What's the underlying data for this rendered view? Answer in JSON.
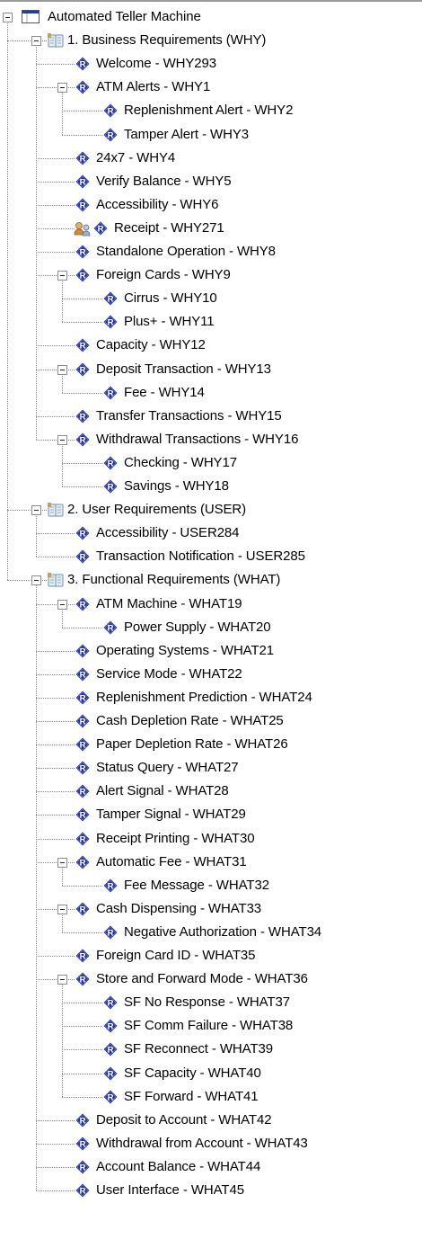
{
  "tree": {
    "root": {
      "label": "Automated Teller Machine",
      "icon": "window-icon"
    },
    "items": [
      {
        "label": "1. Business Requirements (WHY)",
        "level": 1,
        "icon": "book-icon",
        "expander": true
      },
      {
        "label": "Welcome - WHY293",
        "level": 2,
        "icon": "requirement-icon"
      },
      {
        "label": "ATM Alerts - WHY1",
        "level": 2,
        "icon": "requirement-icon",
        "expander": true
      },
      {
        "label": "Replenishment Alert - WHY2",
        "level": 3,
        "icon": "requirement-icon"
      },
      {
        "label": "Tamper Alert - WHY3",
        "level": 3,
        "icon": "requirement-icon"
      },
      {
        "label": "24x7 - WHY4",
        "level": 2,
        "icon": "requirement-icon"
      },
      {
        "label": "Verify Balance - WHY5",
        "level": 2,
        "icon": "requirement-icon"
      },
      {
        "label": "Accessibility - WHY6",
        "level": 2,
        "icon": "requirement-icon"
      },
      {
        "label": "Receipt - WHY271",
        "level": 2,
        "icon": "requirement-icon",
        "extra_icon": "users-icon"
      },
      {
        "label": "Standalone Operation - WHY8",
        "level": 2,
        "icon": "requirement-icon"
      },
      {
        "label": "Foreign Cards - WHY9",
        "level": 2,
        "icon": "requirement-icon",
        "expander": true
      },
      {
        "label": "Cirrus - WHY10",
        "level": 3,
        "icon": "requirement-icon"
      },
      {
        "label": "Plus+ - WHY11",
        "level": 3,
        "icon": "requirement-icon"
      },
      {
        "label": "Capacity - WHY12",
        "level": 2,
        "icon": "requirement-icon"
      },
      {
        "label": "Deposit Transaction - WHY13",
        "level": 2,
        "icon": "requirement-icon",
        "expander": true
      },
      {
        "label": "Fee - WHY14",
        "level": 3,
        "icon": "requirement-icon"
      },
      {
        "label": "Transfer Transactions - WHY15",
        "level": 2,
        "icon": "requirement-icon"
      },
      {
        "label": "Withdrawal Transactions - WHY16",
        "level": 2,
        "icon": "requirement-icon",
        "expander": true
      },
      {
        "label": "Checking - WHY17",
        "level": 3,
        "icon": "requirement-icon"
      },
      {
        "label": "Savings - WHY18",
        "level": 3,
        "icon": "requirement-icon"
      },
      {
        "label": "2. User Requirements (USER)",
        "level": 1,
        "icon": "book-icon",
        "expander": true
      },
      {
        "label": "Accessibility - USER284",
        "level": 2,
        "icon": "requirement-icon"
      },
      {
        "label": "Transaction Notification - USER285",
        "level": 2,
        "icon": "requirement-icon"
      },
      {
        "label": "3. Functional Requirements (WHAT)",
        "level": 1,
        "icon": "book-icon",
        "expander": true
      },
      {
        "label": "ATM Machine - WHAT19",
        "level": 2,
        "icon": "requirement-icon",
        "expander": true
      },
      {
        "label": "Power Supply - WHAT20",
        "level": 3,
        "icon": "requirement-icon"
      },
      {
        "label": "Operating Systems - WHAT21",
        "level": 2,
        "icon": "requirement-icon"
      },
      {
        "label": "Service Mode - WHAT22",
        "level": 2,
        "icon": "requirement-icon"
      },
      {
        "label": "Replenishment Prediction - WHAT24",
        "level": 2,
        "icon": "requirement-icon"
      },
      {
        "label": "Cash Depletion Rate - WHAT25",
        "level": 2,
        "icon": "requirement-icon"
      },
      {
        "label": "Paper Depletion Rate - WHAT26",
        "level": 2,
        "icon": "requirement-icon"
      },
      {
        "label": "Status Query - WHAT27",
        "level": 2,
        "icon": "requirement-icon"
      },
      {
        "label": "Alert Signal - WHAT28",
        "level": 2,
        "icon": "requirement-icon"
      },
      {
        "label": "Tamper Signal - WHAT29",
        "level": 2,
        "icon": "requirement-icon"
      },
      {
        "label": "Receipt Printing - WHAT30",
        "level": 2,
        "icon": "requirement-icon"
      },
      {
        "label": "Automatic Fee - WHAT31",
        "level": 2,
        "icon": "requirement-icon",
        "expander": true
      },
      {
        "label": "Fee Message - WHAT32",
        "level": 3,
        "icon": "requirement-icon"
      },
      {
        "label": "Cash Dispensing - WHAT33",
        "level": 2,
        "icon": "requirement-icon",
        "expander": true
      },
      {
        "label": "Negative Authorization - WHAT34",
        "level": 3,
        "icon": "requirement-icon"
      },
      {
        "label": "Foreign Card ID - WHAT35",
        "level": 2,
        "icon": "requirement-icon"
      },
      {
        "label": "Store and Forward Mode - WHAT36",
        "level": 2,
        "icon": "requirement-icon",
        "expander": true
      },
      {
        "label": "SF No Response - WHAT37",
        "level": 3,
        "icon": "requirement-icon"
      },
      {
        "label": "SF Comm Failure - WHAT38",
        "level": 3,
        "icon": "requirement-icon"
      },
      {
        "label": "SF Reconnect - WHAT39",
        "level": 3,
        "icon": "requirement-icon"
      },
      {
        "label": "SF Capacity - WHAT40",
        "level": 3,
        "icon": "requirement-icon"
      },
      {
        "label": "SF Forward - WHAT41",
        "level": 3,
        "icon": "requirement-icon"
      },
      {
        "label": "Deposit to Account - WHAT42",
        "level": 2,
        "icon": "requirement-icon"
      },
      {
        "label": "Withdrawal from Account - WHAT43",
        "level": 2,
        "icon": "requirement-icon"
      },
      {
        "label": "Account Balance - WHAT44",
        "level": 2,
        "icon": "requirement-icon"
      },
      {
        "label": "User Interface - WHAT45",
        "level": 2,
        "icon": "requirement-icon"
      }
    ]
  },
  "colors": {
    "requirement_icon": "#23328f",
    "book_icon": "#6b8fb0",
    "window_icon": "#1f3f9a",
    "connector": "#888888"
  }
}
